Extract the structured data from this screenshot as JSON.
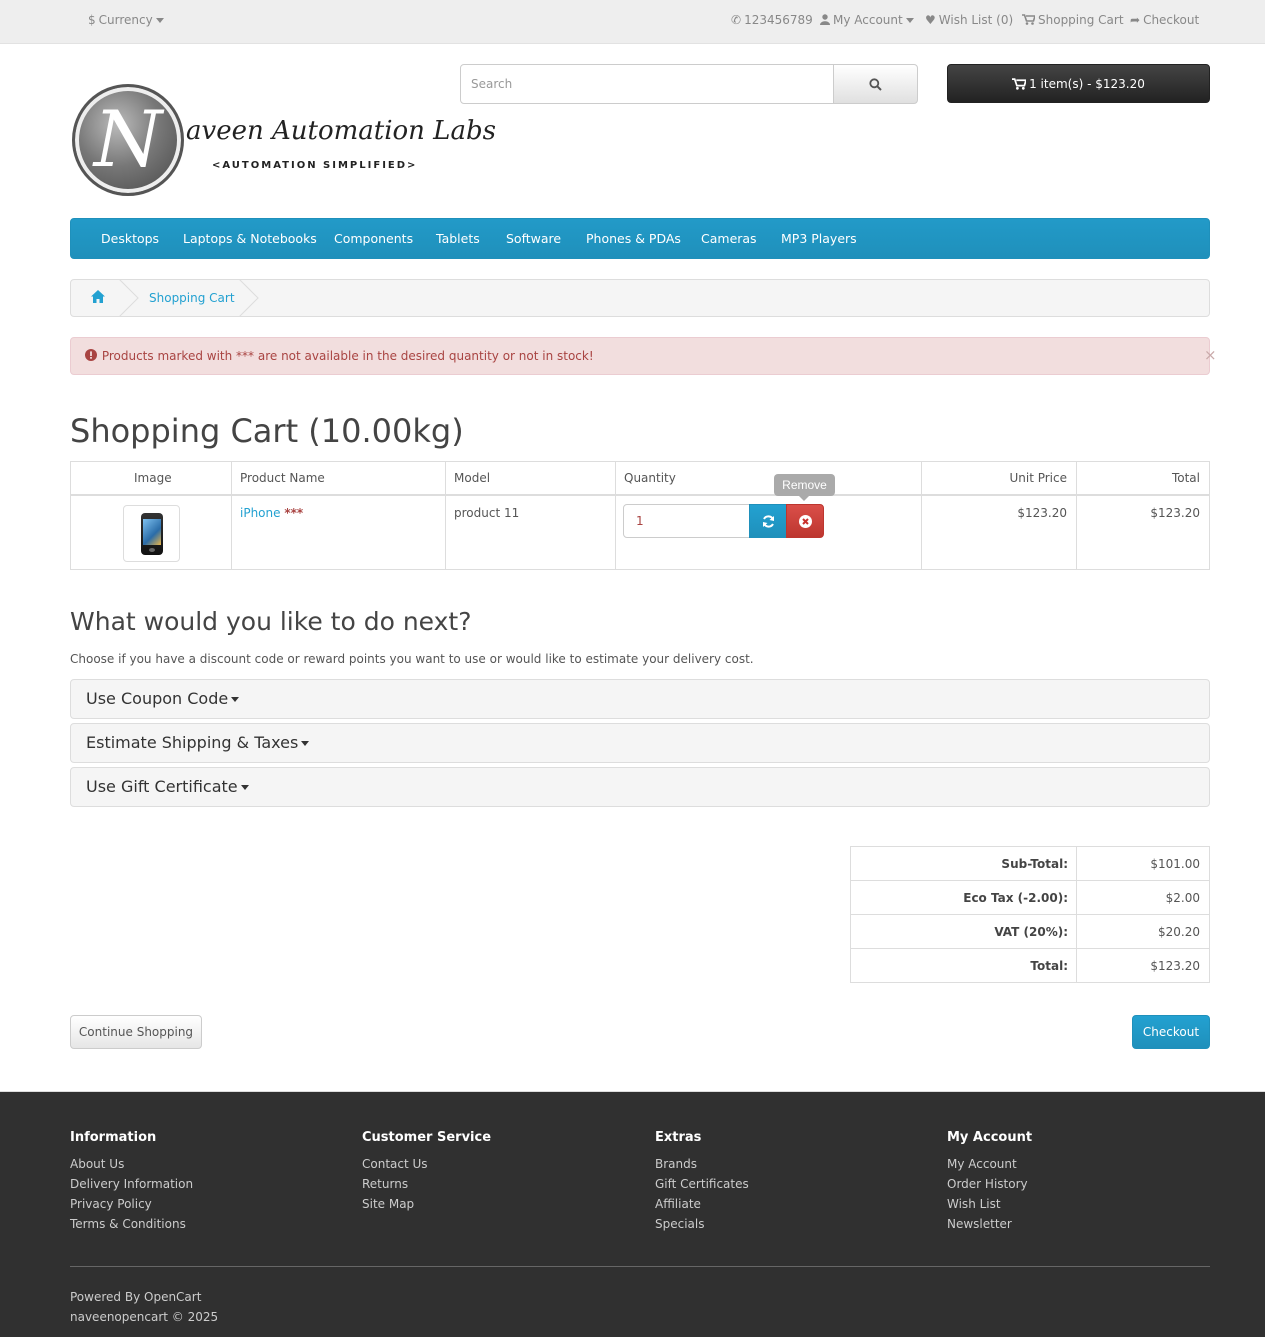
{
  "topbar": {
    "currency_label": "Currency",
    "currency_symbol": "$",
    "phone": "123456789",
    "my_account": "My Account",
    "wish_list": "Wish List (0)",
    "shopping_cart": "Shopping Cart",
    "checkout": "Checkout"
  },
  "logo": {
    "initial": "N",
    "name": "aveen Automation Labs",
    "tagline": "<AUTOMATION SIMPLIFIED>"
  },
  "search": {
    "placeholder": "Search",
    "value": ""
  },
  "cart_button": {
    "label": "1 item(s) - $123.20"
  },
  "menu": {
    "items": [
      "Desktops",
      "Laptops & Notebooks",
      "Components",
      "Tablets",
      "Software",
      "Phones & PDAs",
      "Cameras",
      "MP3 Players"
    ]
  },
  "breadcrumb": {
    "current": "Shopping Cart"
  },
  "alert": {
    "message": "Products marked with *** are not available in the desired quantity or not in stock!",
    "close": "×"
  },
  "page_title": "Shopping Cart  (10.00kg)",
  "cart_table": {
    "headers": [
      "Image",
      "Product Name",
      "Model",
      "Quantity",
      "Unit Price",
      "Total"
    ],
    "rows": [
      {
        "product_name": "iPhone",
        "stock_flag": "***",
        "model": "product 11",
        "quantity": "1",
        "unit_price": "$123.20",
        "total": "$123.20"
      }
    ],
    "remove_tooltip": "Remove"
  },
  "next_section": {
    "title": "What would you like to do next?",
    "description": "Choose if you have a discount code or reward points you want to use or would like to estimate your delivery cost.",
    "panels": [
      "Use Coupon Code",
      "Estimate Shipping & Taxes",
      "Use Gift Certificate"
    ]
  },
  "totals": [
    {
      "label": "Sub-Total:",
      "value": "$101.00"
    },
    {
      "label": "Eco Tax (-2.00):",
      "value": "$2.00"
    },
    {
      "label": "VAT (20%):",
      "value": "$20.20"
    },
    {
      "label": "Total:",
      "value": "$123.20"
    }
  ],
  "buttons": {
    "continue": "Continue Shopping",
    "checkout": "Checkout"
  },
  "footer": {
    "columns": [
      {
        "title": "Information",
        "links": [
          "About Us",
          "Delivery Information",
          "Privacy Policy",
          "Terms & Conditions"
        ]
      },
      {
        "title": "Customer Service",
        "links": [
          "Contact Us",
          "Returns",
          "Site Map"
        ]
      },
      {
        "title": "Extras",
        "links": [
          "Brands",
          "Gift Certificates",
          "Affiliate",
          "Specials"
        ]
      },
      {
        "title": "My Account",
        "links": [
          "My Account",
          "Order History",
          "Wish List",
          "Newsletter"
        ]
      }
    ],
    "powered_prefix": "Powered By",
    "powered_link": "OpenCart",
    "copyright": "naveenopencart © 2025"
  },
  "colors": {
    "accent": "#229ac8",
    "danger": "#da4f49",
    "alert_bg": "#f2dede",
    "footer_bg": "#303030"
  }
}
